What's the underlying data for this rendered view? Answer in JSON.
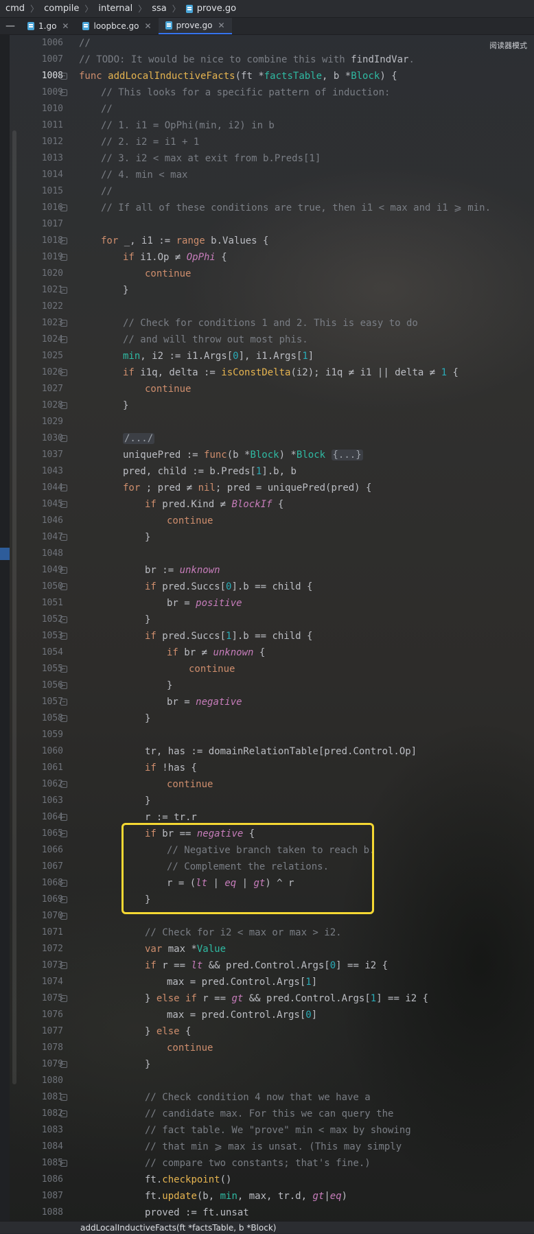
{
  "breadcrumb": [
    "cmd",
    "compile",
    "internal",
    "ssa",
    "prove.go"
  ],
  "tabs": [
    {
      "label": "1.go",
      "active": false
    },
    {
      "label": "loopbce.go",
      "active": false
    },
    {
      "label": "prove.go",
      "active": true
    }
  ],
  "tab_menu_icon": "—",
  "reader_mode_label": "阅读器模式",
  "status_bar_text": "addLocalInductiveFacts(ft *factsTable, b *Block)",
  "current_line": "1008",
  "line_numbers": [
    "1006",
    "1007",
    "1008",
    "1009",
    "1010",
    "1011",
    "1012",
    "1013",
    "1014",
    "1015",
    "1016",
    "1017",
    "1018",
    "1019",
    "1020",
    "1021",
    "1022",
    "1023",
    "1024",
    "1025",
    "1026",
    "1027",
    "1028",
    "1029",
    "1030",
    "1037",
    "1043",
    "1044",
    "1045",
    "1046",
    "1047",
    "1048",
    "1049",
    "1050",
    "1051",
    "1052",
    "1053",
    "1054",
    "1055",
    "1056",
    "1057",
    "1058",
    "1059",
    "1060",
    "1061",
    "1062",
    "1063",
    "1064",
    "1065",
    "1066",
    "1067",
    "1068",
    "1069",
    "1070",
    "1071",
    "1072",
    "1073",
    "1074",
    "1075",
    "1076",
    "1077",
    "1078",
    "1079",
    "1080",
    "1081",
    "1082",
    "1083",
    "1084",
    "1085",
    "1086",
    "1087",
    "1088"
  ],
  "code": {
    "l1006": "//",
    "l1007_a": "// TODO: It would be nice to combine this with ",
    "l1007_b": "findIndVar",
    "l1007_c": ".",
    "l1008_kw": "func ",
    "l1008_fn": "addLocalInductiveFacts",
    "l1008_a": "(",
    "l1008_p1": "ft",
    "l1008_b": " *",
    "l1008_t1": "factsTable",
    "l1008_c": ", ",
    "l1008_p2": "b",
    "l1008_d": " *",
    "l1008_t2": "Block",
    "l1008_e": ") {",
    "l1009": "// This looks for a specific pattern of induction:",
    "l1010": "//",
    "l1011": "// 1. i1 = OpPhi(min, i2) in b",
    "l1012": "// 2. i2 = i1 + 1",
    "l1013": "// 3. i2 < max at exit from b.Preds[1]",
    "l1014": "// 4. min < max",
    "l1015": "//",
    "l1016": "// If all of these conditions are true, then i1 < max and i1 ⩾ min.",
    "l1018_kw1": "for",
    "l1018_a": " _, i1 := ",
    "l1018_kw2": "range",
    "l1018_b": " b.Values {",
    "l1019_kw": "if",
    "l1019_a": " i1.Op ≠ ",
    "l1019_c": "OpPhi",
    "l1019_b": " {",
    "l1020": "continue",
    "l1021": "}",
    "l1023": "// Check for conditions 1 and 2. This is easy to do",
    "l1024": "// and will throw out most phis.",
    "l1025_v": "min",
    "l1025_a": ", i2 := i1.Args[",
    "l1025_n1": "0",
    "l1025_b": "], i1.Args[",
    "l1025_n2": "1",
    "l1025_c": "]",
    "l1026_kw": "if",
    "l1026_a": " i1q, delta := ",
    "l1026_fn": "isConstDelta",
    "l1026_b": "(i2); i1q ≠ i1 || delta ≠ ",
    "l1026_n": "1",
    "l1026_c": " {",
    "l1027": "continue",
    "l1028": "}",
    "l1030": "/.../",
    "l1037_a": "uniquePred := ",
    "l1037_kw": "func",
    "l1037_b": "(b *",
    "l1037_t1": "Block",
    "l1037_c": ") *",
    "l1037_t2": "Block",
    "l1037_d": " ",
    "l1037_fold": "{...}",
    "l1043": "pred, child := b.Preds[1].b, b",
    "l1043_pre": "pred, child := b.Preds[",
    "l1043_n": "1",
    "l1043_post": "].b, b",
    "l1044_kw": "for",
    "l1044_a": " ; pred ≠ ",
    "l1044_nil": "nil",
    "l1044_b": "; pred = uniquePred(pred) {",
    "l1045_kw": "if",
    "l1045_a": " pred.Kind ≠ ",
    "l1045_c": "BlockIf",
    "l1045_b": " {",
    "l1046": "continue",
    "l1047": "}",
    "l1049_a": "br := ",
    "l1049_c": "unknown",
    "l1050_kw": "if",
    "l1050_a": " pred.Succs[",
    "l1050_n": "0",
    "l1050_b": "].b == child {",
    "l1051_a": "br = ",
    "l1051_c": "positive",
    "l1052": "}",
    "l1053_kw": "if",
    "l1053_a": " pred.Succs[",
    "l1053_n": "1",
    "l1053_b": "].b == child {",
    "l1054_kw": "if",
    "l1054_a": " br ≠ ",
    "l1054_c": "unknown",
    "l1054_b": " {",
    "l1055": "continue",
    "l1056": "}",
    "l1057_a": "br = ",
    "l1057_c": "negative",
    "l1058": "}",
    "l1060": "tr, has := domainRelationTable[pred.Control.Op]",
    "l1061_kw": "if",
    "l1061_a": " !has {",
    "l1062": "continue",
    "l1063": "}",
    "l1064": "r := tr.r",
    "l1065_kw": "if",
    "l1065_a": " br == ",
    "l1065_c": "negative",
    "l1065_b": " {",
    "l1066": "// Negative branch taken to reach b.",
    "l1067": "// Complement the relations.",
    "l1068_a": "r = (",
    "l1068_c1": "lt",
    "l1068_b": " | ",
    "l1068_c2": "eq",
    "l1068_d": " | ",
    "l1068_c3": "gt",
    "l1068_e": ") ^ r",
    "l1069": "}",
    "l1071": "// Check for i2 < max or max > i2.",
    "l1072_kw": "var",
    "l1072_a": " max *",
    "l1072_t": "Value",
    "l1073_kw": "if",
    "l1073_a": " r == ",
    "l1073_c": "lt",
    "l1073_b": " && pred.Control.Args[",
    "l1073_n": "0",
    "l1073_d": "] == i2 {",
    "l1074_a": "max = pred.Control.Args[",
    "l1074_n": "1",
    "l1074_b": "]",
    "l1075_a": "} ",
    "l1075_kw": "else if",
    "l1075_b": " r == ",
    "l1075_c": "gt",
    "l1075_d": " && pred.Control.Args[",
    "l1075_n": "1",
    "l1075_e": "] == i2 {",
    "l1076_a": "max = pred.Control.Args[",
    "l1076_n": "0",
    "l1076_b": "]",
    "l1077_a": "} ",
    "l1077_kw": "else",
    "l1077_b": " {",
    "l1078": "continue",
    "l1079": "}",
    "l1081": "// Check condition 4 now that we have a",
    "l1082": "// candidate max. For this we can query the",
    "l1083": "// fact table. We \"prove\" min < max by showing",
    "l1084": "// that min ⩾ max is unsat. (This may simply",
    "l1085": "// compare two constants; that's fine.)",
    "l1086_a": "ft.",
    "l1086_fn": "checkpoint",
    "l1086_b": "()",
    "l1087_a": "ft.",
    "l1087_fn": "update",
    "l1087_b": "(b, ",
    "l1087_v": "min",
    "l1087_c": ", max, tr.d, ",
    "l1087_c1": "gt",
    "l1087_d": "|",
    "l1087_c2": "eq",
    "l1087_e": ")",
    "l1088_a": "proved := ft.unsat"
  }
}
